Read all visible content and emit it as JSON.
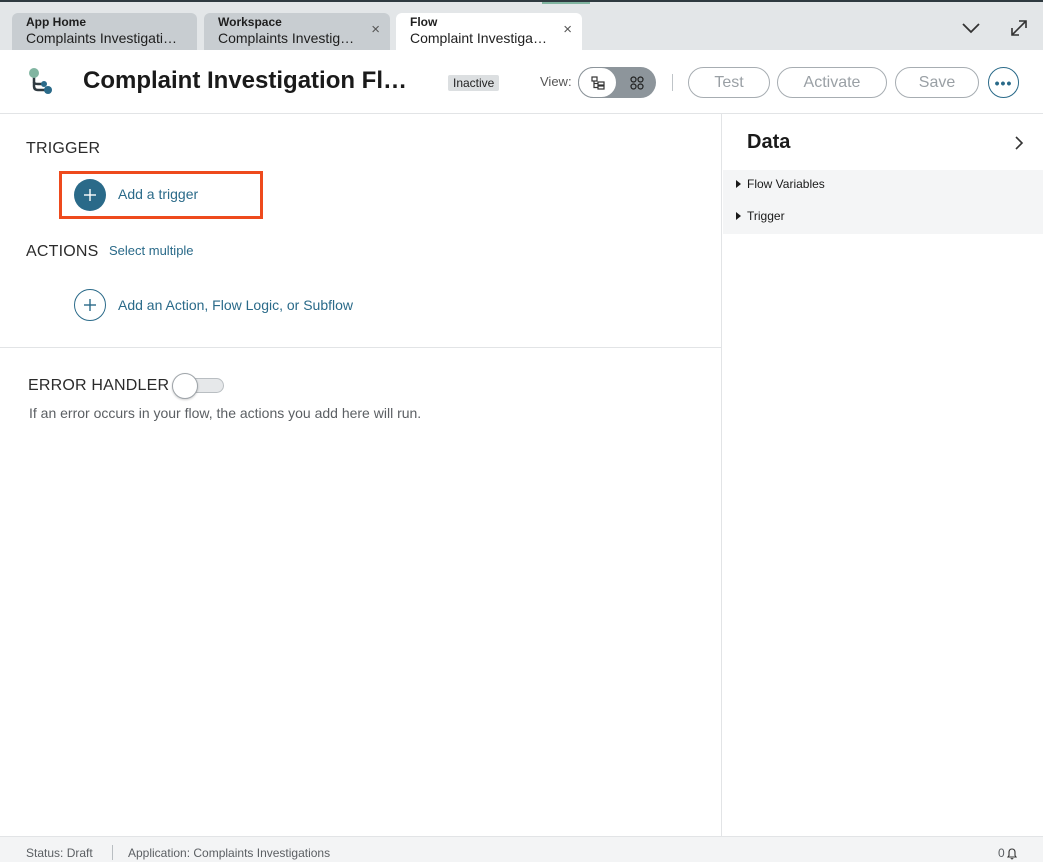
{
  "tabs": [
    {
      "title": "App Home",
      "subtitle": "Complaints Investigati…",
      "closable": false,
      "active": false
    },
    {
      "title": "Workspace",
      "subtitle": "Complaints Investig…",
      "closable": true,
      "active": false
    },
    {
      "title": "Flow",
      "subtitle": "Complaint Investiga…",
      "closable": true,
      "active": true
    }
  ],
  "tab_close_glyph": "×",
  "tabbar_icons": [
    "chevron-down-icon",
    "expand-icon"
  ],
  "header": {
    "title": "Complaint Investigation Fl…",
    "status": "Inactive",
    "view_label": "View:",
    "view_options": [
      "tree-view-icon",
      "diagram-view-icon"
    ],
    "buttons": {
      "test": "Test",
      "activate": "Activate",
      "save": "Save"
    },
    "more_glyph": "•••"
  },
  "main": {
    "trigger_heading": "TRIGGER",
    "add_trigger": "Add a trigger",
    "actions_heading": "ACTIONS",
    "select_multiple": "Select multiple",
    "add_action": "Add an Action, Flow Logic, or Subflow",
    "error_heading": "ERROR HANDLER",
    "error_enabled": false,
    "error_help": "If an error occurs in your flow, the actions you add here will run."
  },
  "panel": {
    "title": "Data",
    "items": [
      "Flow Variables",
      "Trigger"
    ]
  },
  "statusbar": {
    "status": "Status: Draft",
    "application": "Application: Complaints Investigations",
    "notifications": "0"
  },
  "colors": {
    "accent": "#2a6a89",
    "highlight": "#ee4a1d",
    "tab_bg": "#c8cdd1",
    "logo_green": "#81b5a1"
  }
}
